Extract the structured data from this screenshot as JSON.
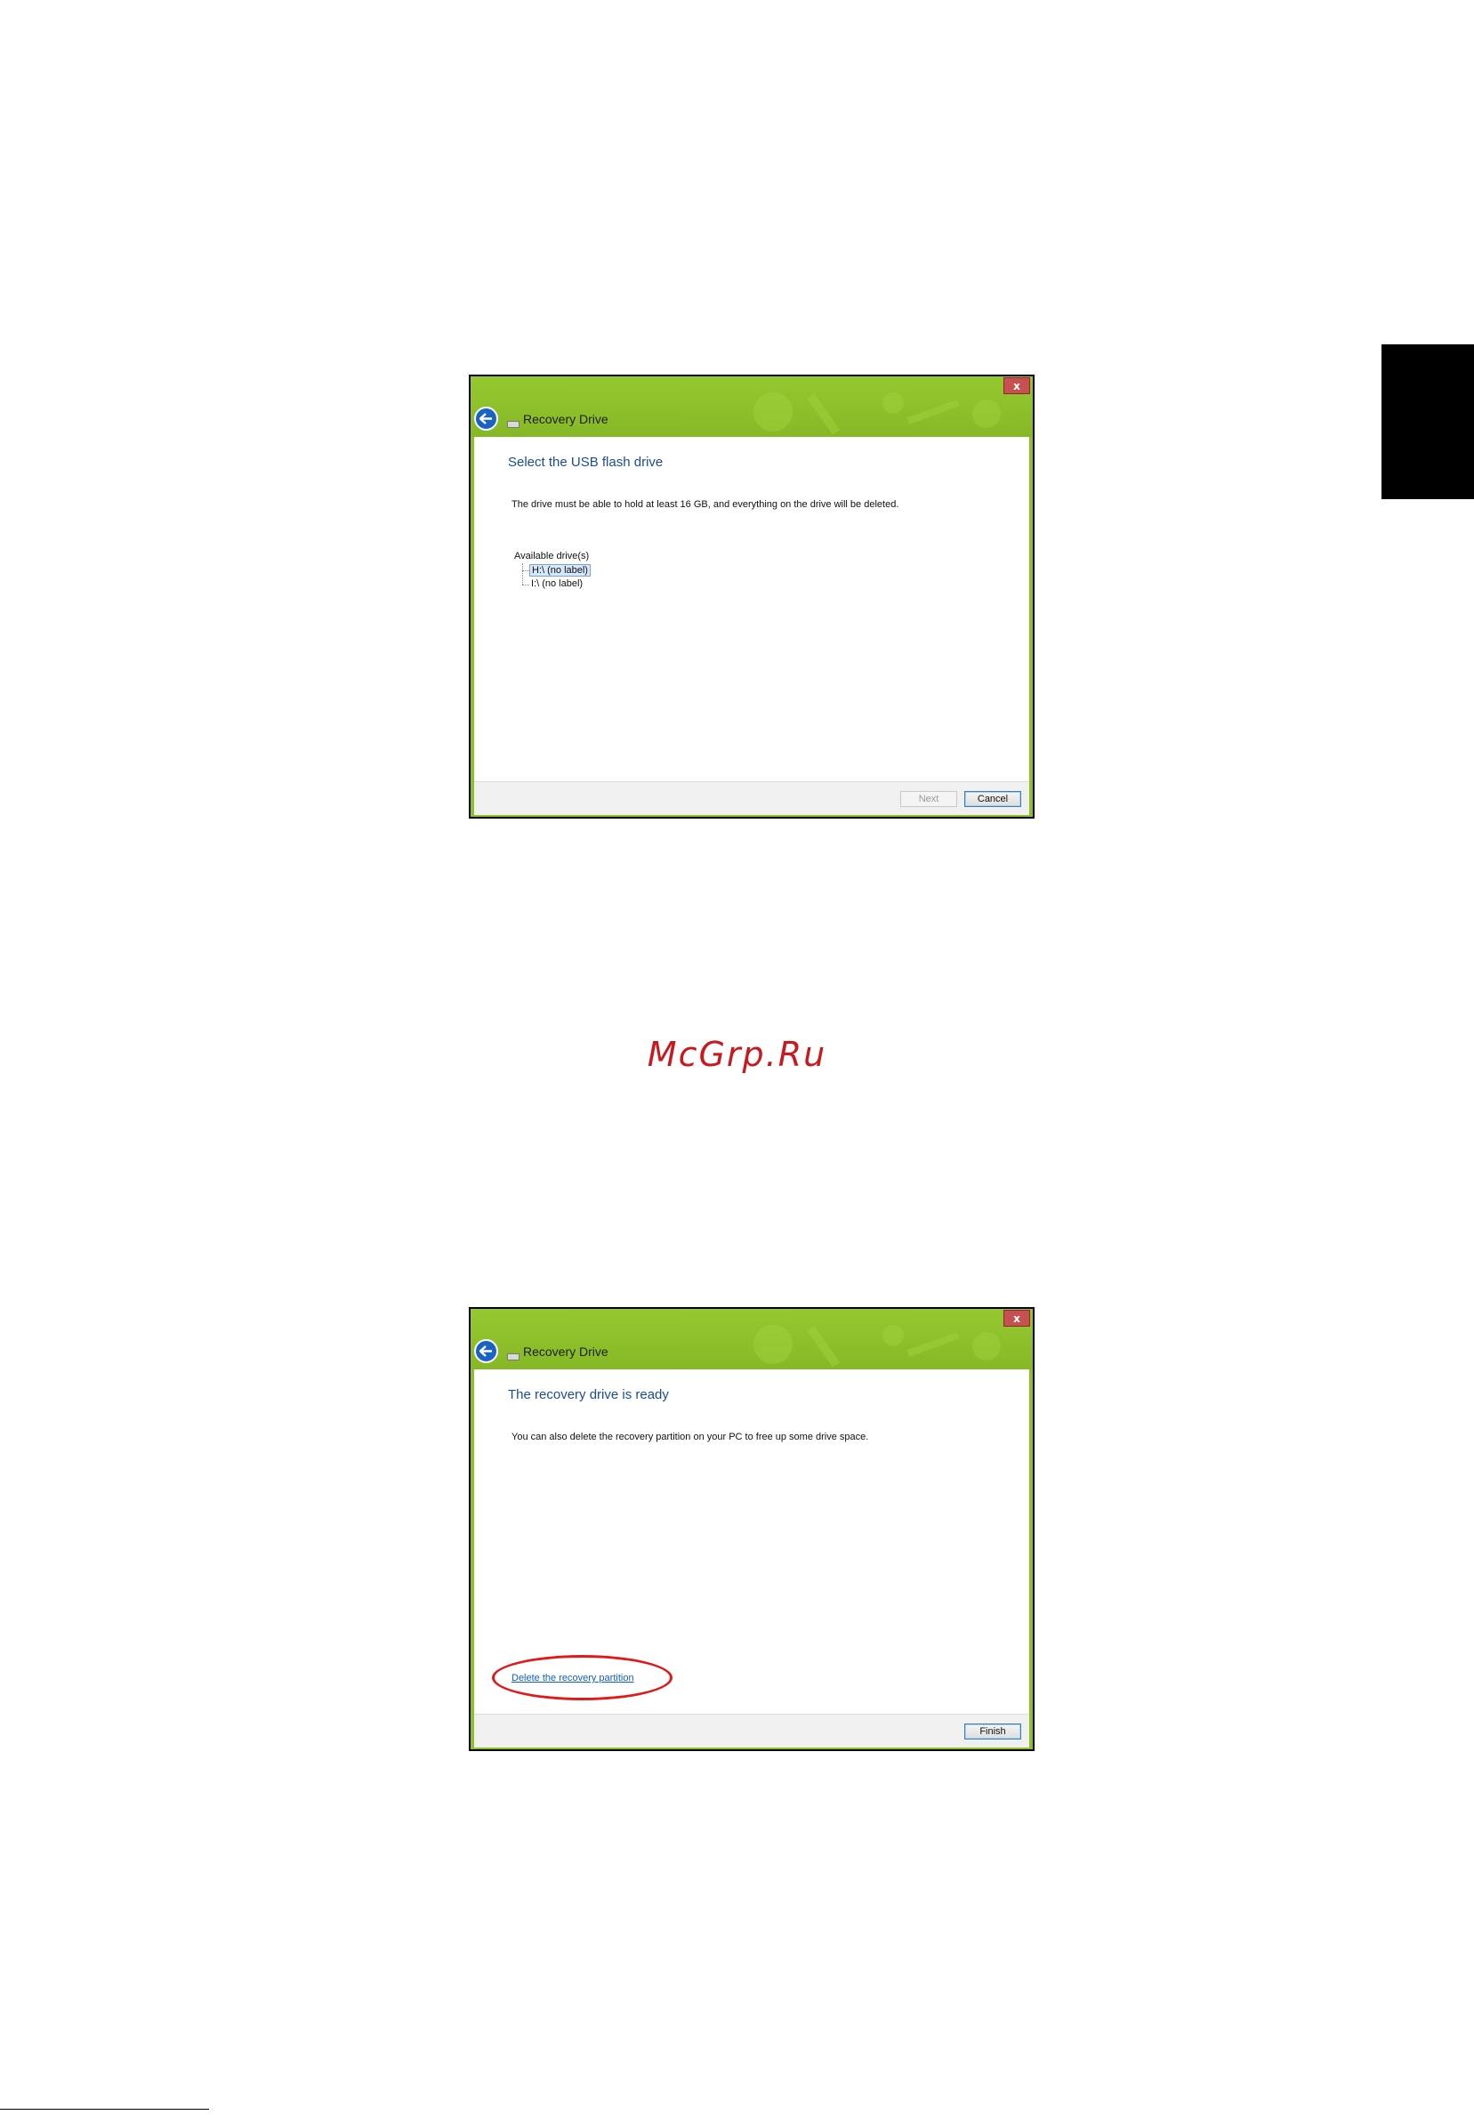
{
  "page": {
    "watermark": "McGrp.Ru"
  },
  "window1": {
    "title": "Recovery Drive",
    "close_label": "x",
    "heading": "Select the USB flash drive",
    "description": "The drive must be able to hold at least 16 GB, and everything on the drive will be deleted.",
    "tree_label": "Available drive(s)",
    "drives": [
      {
        "label": "H:\\ (no label)",
        "selected": true
      },
      {
        "label": "I:\\ (no label)",
        "selected": false
      }
    ],
    "buttons": {
      "next": "Next",
      "cancel": "Cancel"
    }
  },
  "window2": {
    "title": "Recovery Drive",
    "close_label": "x",
    "heading": "The recovery drive is ready",
    "description": "You can also delete the recovery partition on your PC to free up some drive space.",
    "link": "Delete the recovery partition",
    "buttons": {
      "finish": "Finish"
    }
  },
  "colors": {
    "titlebar_green": "#8dbf2a",
    "heading_blue": "#1b4d8f",
    "link_blue": "#0b5fcc",
    "highlight_red": "#e01a1a",
    "watermark_red": "#c9191f"
  }
}
